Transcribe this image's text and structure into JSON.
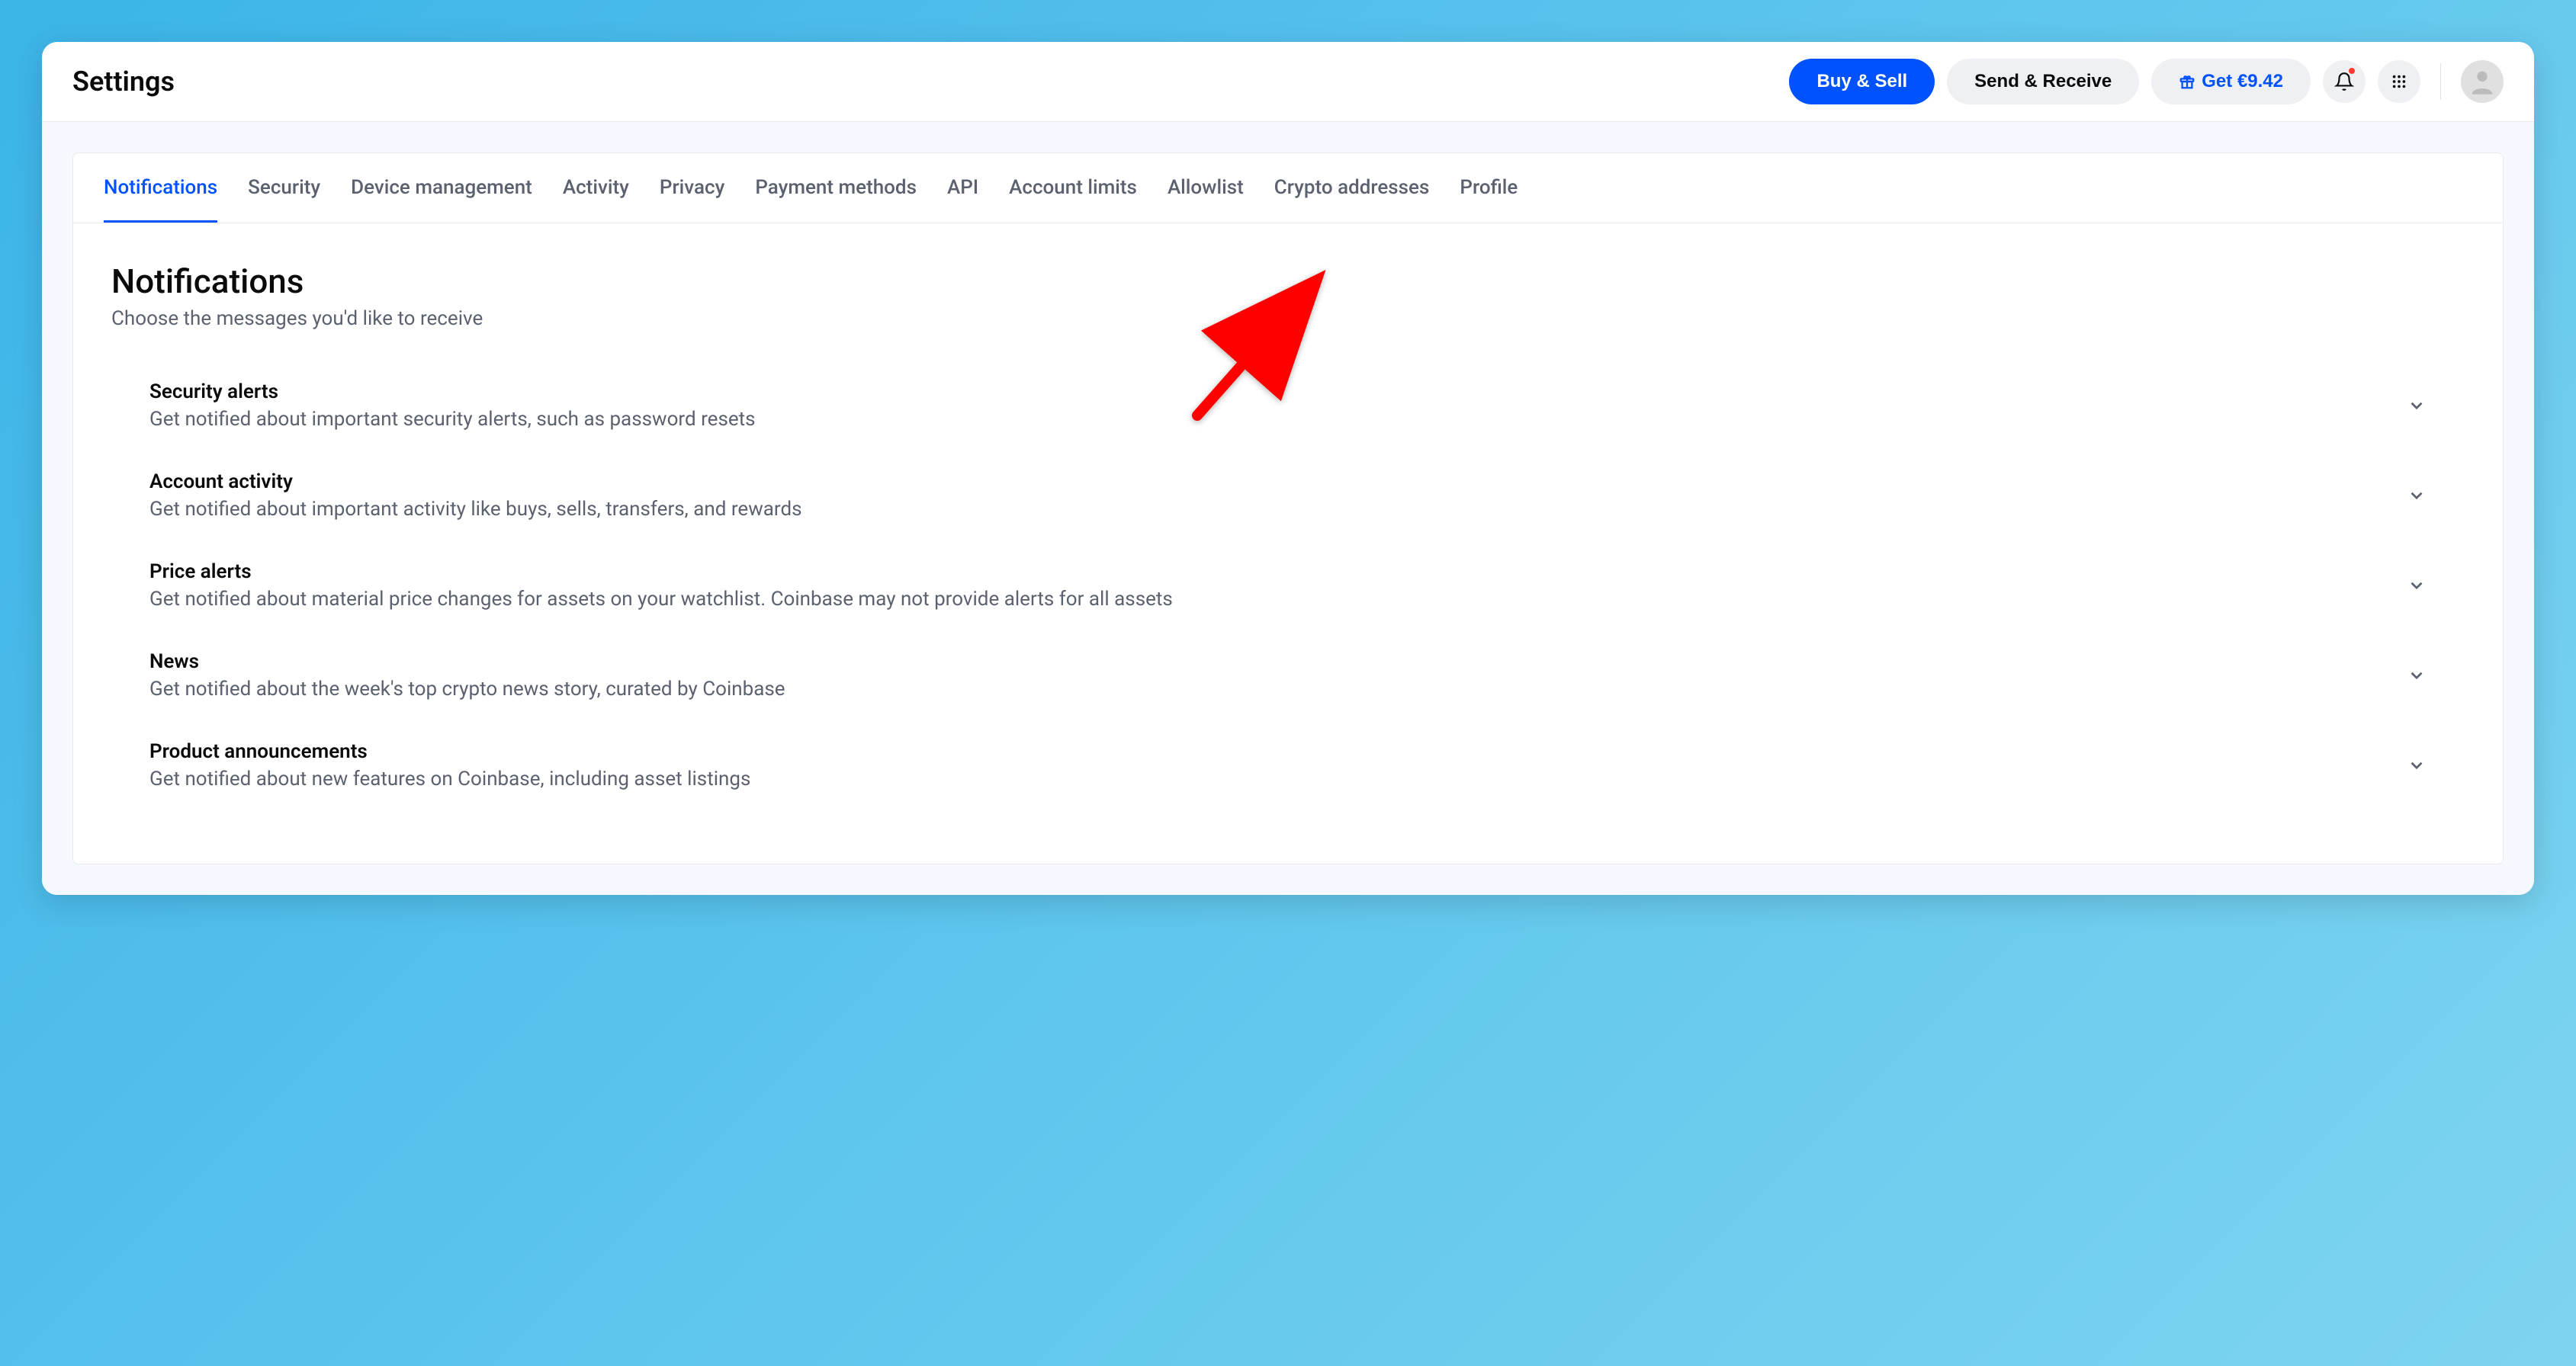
{
  "header": {
    "title": "Settings",
    "buy_sell": "Buy & Sell",
    "send_receive": "Send & Receive",
    "get_reward": "Get €9.42"
  },
  "tabs": [
    "Notifications",
    "Security",
    "Device management",
    "Activity",
    "Privacy",
    "Payment methods",
    "API",
    "Account limits",
    "Allowlist",
    "Crypto addresses",
    "Profile"
  ],
  "active_tab_index": 0,
  "section": {
    "title": "Notifications",
    "subtitle": "Choose the messages you'd like to receive"
  },
  "settings": [
    {
      "title": "Security alerts",
      "desc": "Get notified about important security alerts, such as password resets"
    },
    {
      "title": "Account activity",
      "desc": "Get notified about important activity like buys, sells, transfers, and rewards"
    },
    {
      "title": "Price alerts",
      "desc": "Get notified about material price changes for assets on your watchlist. Coinbase may not provide alerts for all assets"
    },
    {
      "title": "News",
      "desc": "Get notified about the week's top crypto news story, curated by Coinbase"
    },
    {
      "title": "Product announcements",
      "desc": "Get notified about new features on Coinbase, including asset listings"
    }
  ]
}
